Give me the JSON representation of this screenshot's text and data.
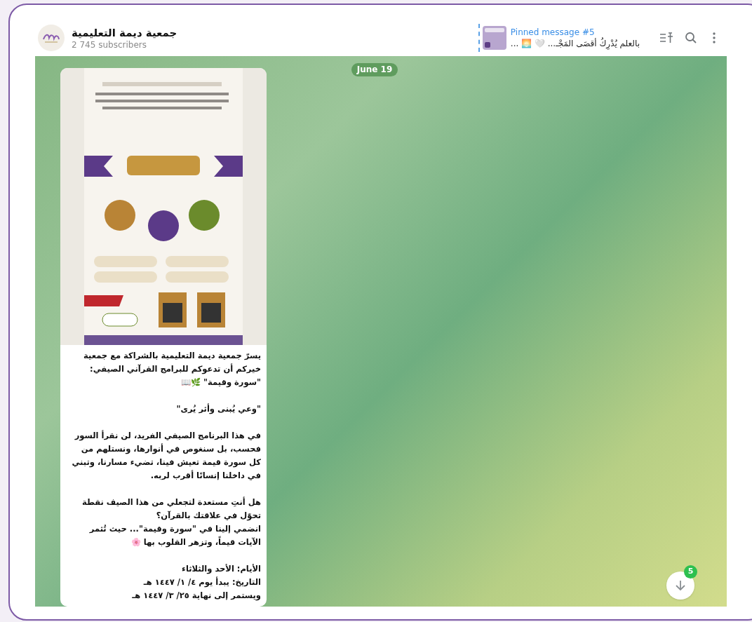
{
  "header": {
    "channel_name": "جمعية ديمة التعليمية",
    "subscribers": "2 745 subscribers",
    "pinned": {
      "title": "Pinned message #5",
      "preview": "بالعلم يُدْرِكُ أقصَى المَجْـ... 🤍 🌅 ..."
    }
  },
  "chat": {
    "date": "June 19",
    "message": {
      "paragraphs": [
        [
          "يسرّ جمعية ديمة التعليمية بالشراكة مع جمعية",
          "خيركم أن تدعوكم للبرامج القرآني الصيفي:",
          "\"سورة وقيمة\" 🌿📖"
        ],
        [
          "\"وعي يُبنى وأثر يُرى\""
        ],
        [
          "في هذا البرنامج الصيفي الفريد، لن نقرأ السور",
          "فحسب، بل سنغوص في أنوارها، ونستلهم من",
          "كل سورة قيمة تعيش فينا، تضيء مسارنا، وتبني",
          "في داخلنا إنسانًا أقرب لربه."
        ],
        [
          "هل أنتِ مستعدة لتجعلي من هذا الصيف نقطة",
          "تحوّل في علاقتك بالقرآن؟",
          "انضمي إلينا في \"سورة وقيمة\"... حيث تُثمر",
          "الآيات قيماً، وتزهر القلوب بها 🌸"
        ],
        [
          "الأيام: الأحد والثلاثاء",
          "التاريخ: يبدأ يوم ٤/ ١/ ١٤٤٧ هـ",
          "ويستمر إلى نهاية ٢٥/ ٣/ ١٤٤٧ هـ"
        ]
      ]
    },
    "scroll_button": {
      "badge": "5"
    }
  }
}
